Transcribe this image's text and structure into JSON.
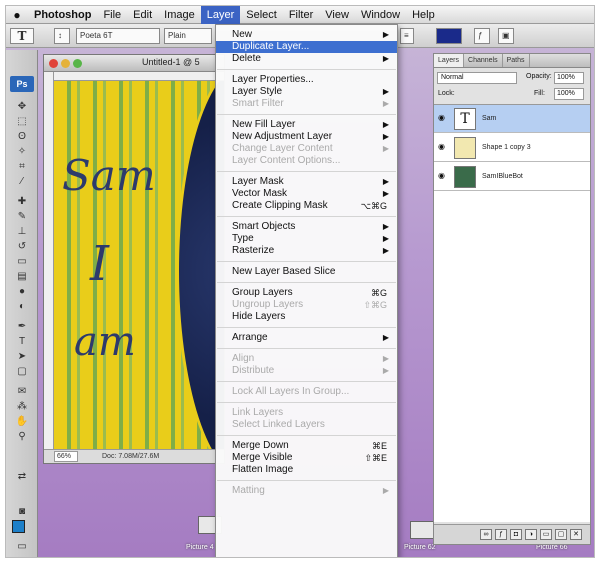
{
  "menubar": {
    "items": [
      "Photoshop",
      "File",
      "Edit",
      "Image",
      "Layer",
      "Select",
      "Filter",
      "View",
      "Window",
      "Help"
    ],
    "active": "Layer"
  },
  "optbar": {
    "font_family": "Poeta 6T",
    "font_style": "Plain"
  },
  "document": {
    "title": "Untitled-1 @ 5",
    "zoom": "66%",
    "size": "Doc: 7.08M/27.6M",
    "canvas_words": [
      "Sam",
      "I",
      "am"
    ]
  },
  "desktop": {
    "labels": [
      "Picture 4",
      "Picture 62",
      "Picture 66"
    ]
  },
  "layers_panel": {
    "tabs": [
      "Layers",
      "Channels",
      "Paths"
    ],
    "blend_mode": "Normal",
    "opacity_label": "Opacity:",
    "opacity_value": "100%",
    "lock_label": "Lock:",
    "fill_label": "Fill:",
    "fill_value": "100%",
    "layers": [
      {
        "name": "Sam",
        "thumb": "T",
        "selected": true
      },
      {
        "name": "Shape 1 copy 3",
        "thumb": "",
        "selected": false
      },
      {
        "name": "SamIBlueBot",
        "thumb": "",
        "selected": false
      }
    ]
  },
  "layer_menu": {
    "items": [
      {
        "label": "New",
        "submenu": true
      },
      {
        "label": "Duplicate Layer...",
        "highlight": true
      },
      {
        "label": "Delete",
        "submenu": true
      },
      {
        "sep": true
      },
      {
        "label": "Layer Properties..."
      },
      {
        "label": "Layer Style",
        "submenu": true
      },
      {
        "label": "Smart Filter",
        "disabled": true,
        "submenu": true
      },
      {
        "sep": true
      },
      {
        "label": "New Fill Layer",
        "submenu": true
      },
      {
        "label": "New Adjustment Layer",
        "submenu": true
      },
      {
        "label": "Change Layer Content",
        "disabled": true,
        "submenu": true
      },
      {
        "label": "Layer Content Options...",
        "disabled": true
      },
      {
        "sep": true
      },
      {
        "label": "Layer Mask",
        "submenu": true
      },
      {
        "label": "Vector Mask",
        "submenu": true
      },
      {
        "label": "Create Clipping Mask",
        "shortcut": "⌥⌘G"
      },
      {
        "sep": true
      },
      {
        "label": "Smart Objects",
        "submenu": true
      },
      {
        "label": "Type",
        "submenu": true
      },
      {
        "label": "Rasterize",
        "submenu": true
      },
      {
        "sep": true
      },
      {
        "label": "New Layer Based Slice"
      },
      {
        "sep": true
      },
      {
        "label": "Group Layers",
        "shortcut": "⌘G"
      },
      {
        "label": "Ungroup Layers",
        "disabled": true,
        "shortcut": "⇧⌘G"
      },
      {
        "label": "Hide Layers"
      },
      {
        "sep": true
      },
      {
        "label": "Arrange",
        "submenu": true
      },
      {
        "sep": true
      },
      {
        "label": "Align",
        "disabled": true,
        "submenu": true
      },
      {
        "label": "Distribute",
        "disabled": true,
        "submenu": true
      },
      {
        "sep": true
      },
      {
        "label": "Lock All Layers In Group...",
        "disabled": true
      },
      {
        "sep": true
      },
      {
        "label": "Link Layers",
        "disabled": true
      },
      {
        "label": "Select Linked Layers",
        "disabled": true
      },
      {
        "sep": true
      },
      {
        "label": "Merge Down",
        "shortcut": "⌘E"
      },
      {
        "label": "Merge Visible",
        "shortcut": "⇧⌘E"
      },
      {
        "label": "Flatten Image"
      },
      {
        "sep": true
      },
      {
        "label": "Matting",
        "disabled": true,
        "submenu": true
      }
    ]
  }
}
